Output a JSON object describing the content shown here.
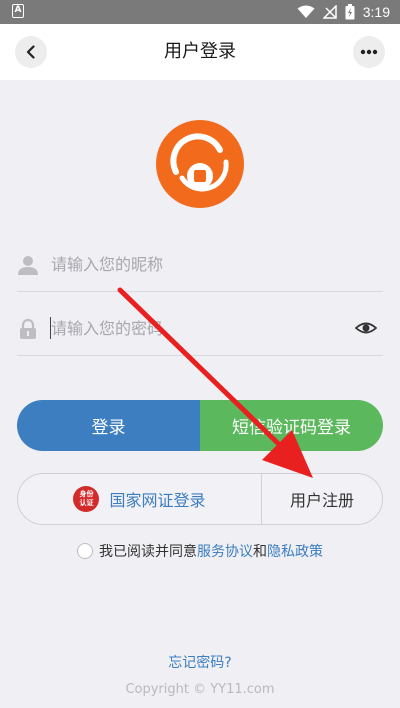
{
  "status_bar": {
    "time": "3:19",
    "left_badge": "A"
  },
  "nav": {
    "title": "用户登录"
  },
  "fields": {
    "username_placeholder": "请输入您的昵称",
    "password_placeholder": "请输入您的密码"
  },
  "buttons": {
    "login": "登录",
    "sms_login": "短信验证码登录",
    "gov_login": "国家网证登录",
    "register": "用户注册"
  },
  "gov_badge": {
    "line1": "身份",
    "line2": "认证"
  },
  "agreement": {
    "prefix": "我已阅读并同意",
    "service": "服务协议",
    "and": "和",
    "privacy": "隐私政策"
  },
  "footer": {
    "forgot": "忘记密码?",
    "copyright": "Copyright © YY11.com"
  },
  "colors": {
    "primary_blue": "#3c7ec0",
    "green": "#5cb85c",
    "logo_orange": "#f26a1b",
    "annotation_red": "#e8201f"
  }
}
